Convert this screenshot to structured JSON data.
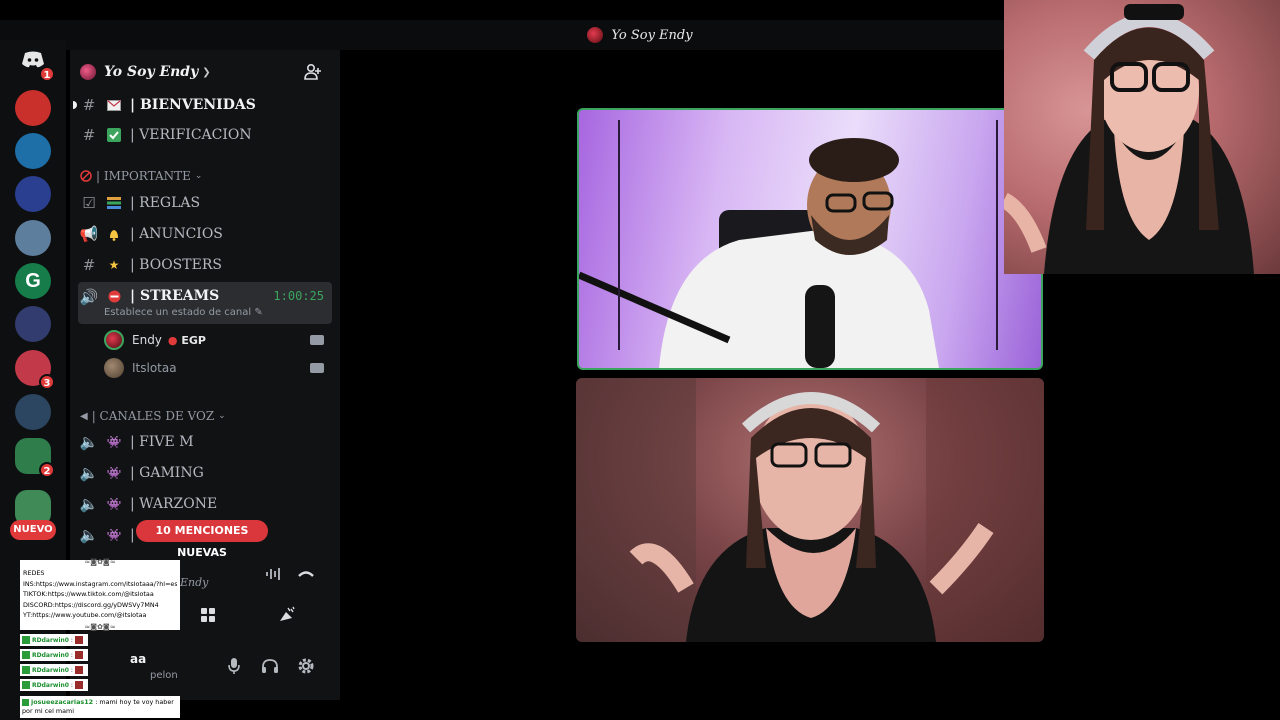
{
  "window": {
    "title": "Yo Soy Endy"
  },
  "rail": {
    "home_badge": "1",
    "servers": [
      {
        "name": "server-1",
        "color": "#c9302c"
      },
      {
        "name": "server-2",
        "color": "#1e6fa8"
      },
      {
        "name": "server-3",
        "color": "#2a3f8f"
      },
      {
        "name": "server-4",
        "color": "#5e7e9e"
      },
      {
        "name": "server-5",
        "color": "#167c4a"
      },
      {
        "name": "server-6",
        "color": "#323c6e"
      },
      {
        "name": "server-7",
        "color": "#c23a4a",
        "badge": "3"
      },
      {
        "name": "server-8",
        "color": "#2c4560"
      },
      {
        "name": "server-9",
        "color": "#2e7d4b",
        "badge": "2"
      },
      {
        "name": "server-10",
        "color": "#3f8a56"
      }
    ],
    "nuevo_label": "NUEVO"
  },
  "server": {
    "name": "Yo Soy Endy"
  },
  "channels": {
    "bienvenidas": "| BIENVENIDAS",
    "verificacion": "| VERIFICACION",
    "cat_importante": "| IMPORTANTE",
    "reglas": "| REGLAS",
    "anuncios": "| ANUNCIOS",
    "boosters": "| BOOSTERS",
    "streams": "| STREAMS",
    "streams_timer": "1:00:25",
    "streams_status": "Establece un estado de canal",
    "cat_voz": "| CANALES DE VOZ",
    "fivem": "| FIVE M",
    "gaming": "| GAMING",
    "warzone": "| WARZONE",
    "last_partial": "|"
  },
  "voice_users": [
    {
      "name": "Endy",
      "tag": "EGP"
    },
    {
      "name": "Itslotaa",
      "tag": ""
    }
  ],
  "mentions": {
    "label": "10 MENCIONES NUEVAS"
  },
  "voice_panel": {
    "server_name_partial": "Endy"
  },
  "user_bar": {
    "name_partial": "aa",
    "status_partial": "pelon"
  },
  "overlay": {
    "redes_lines": [
      "REDES",
      "INS:https://www.instagram.com/itslotaaa/?hl=es",
      "TIKTOK:https://www.tiktok.com/@itslotaa",
      "DISCORD:https://discord.gg/yDWSVy7MN4",
      "YT:https://www.youtube.com/@itslotaa"
    ],
    "deco": "≈◙✿◙≈",
    "chat_users": [
      "RDdarwin0",
      "RDdarwin0",
      "RDdarwin0",
      "RDdarwin0"
    ],
    "last_user": "josueezacarias12",
    "last_message_1": ": mami hoy te voy haber",
    "last_message_2": "por mi cel mami"
  }
}
